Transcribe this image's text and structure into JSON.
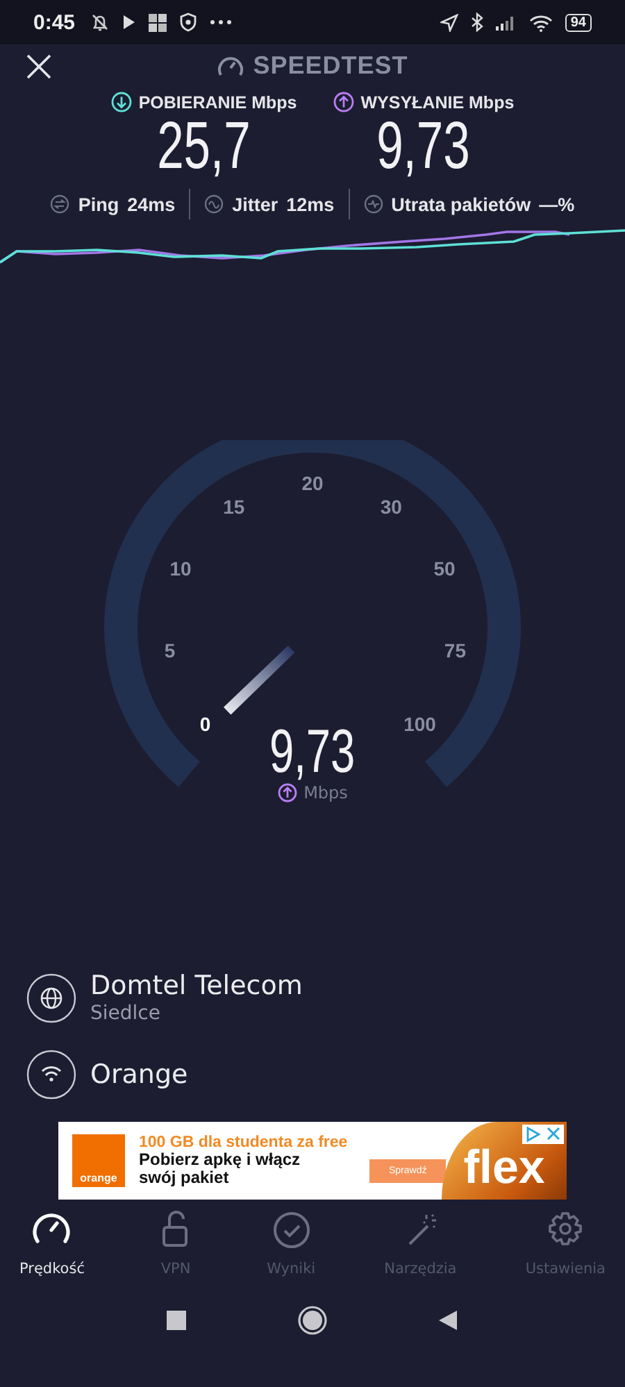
{
  "status_bar": {
    "time": "0:45",
    "battery": "94"
  },
  "header": {
    "title": "SPEEDTEST"
  },
  "results": [
    {
      "kind": "download",
      "label": "POBIERANIE",
      "unit": "Mbps",
      "value": "25,7"
    },
    {
      "kind": "upload",
      "label": "WYSYŁANIE",
      "unit": "Mbps",
      "value": "9,73"
    }
  ],
  "metrics": [
    {
      "kind": "ping",
      "label": "Ping",
      "value": "24ms"
    },
    {
      "kind": "jitter",
      "label": "Jitter",
      "value": "12ms"
    },
    {
      "kind": "loss",
      "label": "Utrata pakietów",
      "value": "—%"
    }
  ],
  "gauge": {
    "ticks": [
      "0",
      "5",
      "10",
      "15",
      "20",
      "30",
      "50",
      "75",
      "100"
    ],
    "value": "9,73",
    "unit": "Mbps",
    "kind": "upload"
  },
  "provider": {
    "name": "Domtel Telecom",
    "location": "Siedlce"
  },
  "network": {
    "name": "Orange"
  },
  "ad": {
    "brand": "orange",
    "headline": "100 GB dla studenta za free",
    "text": "Pobierz apkę i włącz swój pakiet",
    "button": "Sprawdź",
    "logo": "flex"
  },
  "nav": [
    {
      "label": "Prędkość",
      "kind": "gauge",
      "selected": true
    },
    {
      "label": "VPN",
      "kind": "lock",
      "selected": false
    },
    {
      "label": "Wyniki",
      "kind": "check",
      "selected": false
    },
    {
      "label": "Narzędzia",
      "kind": "wand",
      "selected": false
    },
    {
      "label": "Ustawienia",
      "kind": "gear",
      "selected": false
    }
  ]
}
